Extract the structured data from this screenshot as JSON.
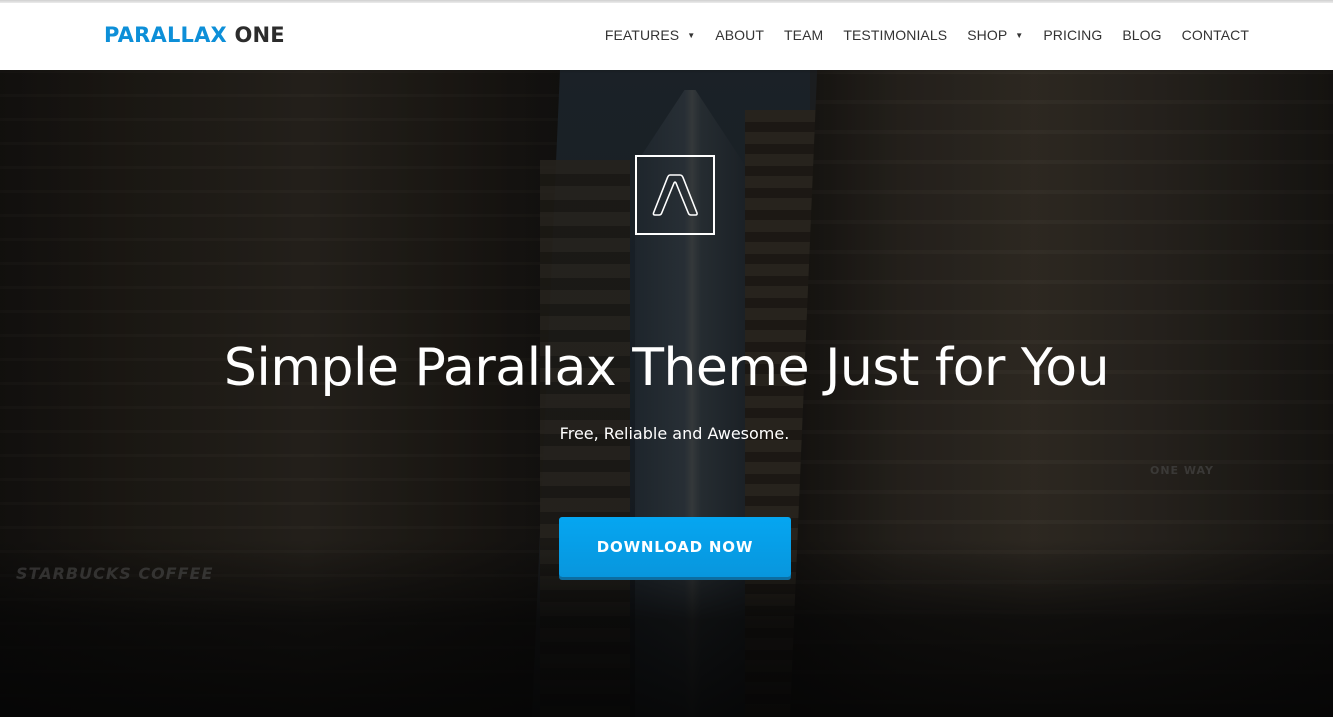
{
  "brand": {
    "name_part1": "PARALLAX",
    "name_part2": "ONE",
    "colors": {
      "accent": "#0d8fd8",
      "dark": "#2c2c2c",
      "button": "#05a6f1"
    }
  },
  "nav": {
    "items": [
      {
        "label": "FEATURES",
        "has_dropdown": true
      },
      {
        "label": "ABOUT",
        "has_dropdown": false
      },
      {
        "label": "TEAM",
        "has_dropdown": false
      },
      {
        "label": "TESTIMONIALS",
        "has_dropdown": false
      },
      {
        "label": "SHOP",
        "has_dropdown": true
      },
      {
        "label": "PRICING",
        "has_dropdown": false
      },
      {
        "label": "BLOG",
        "has_dropdown": false
      },
      {
        "label": "CONTACT",
        "has_dropdown": false
      }
    ],
    "caret": "▼"
  },
  "hero": {
    "logo_icon": "chevron-a-logo-icon",
    "title": "Simple Parallax Theme Just for You",
    "subtitle": "Free, Reliable and Awesome.",
    "cta_label": "DOWNLOAD NOW",
    "background": "city street photo",
    "sign_text": "STARBUCKS COFFEE",
    "street_sign": "ONE WAY"
  }
}
